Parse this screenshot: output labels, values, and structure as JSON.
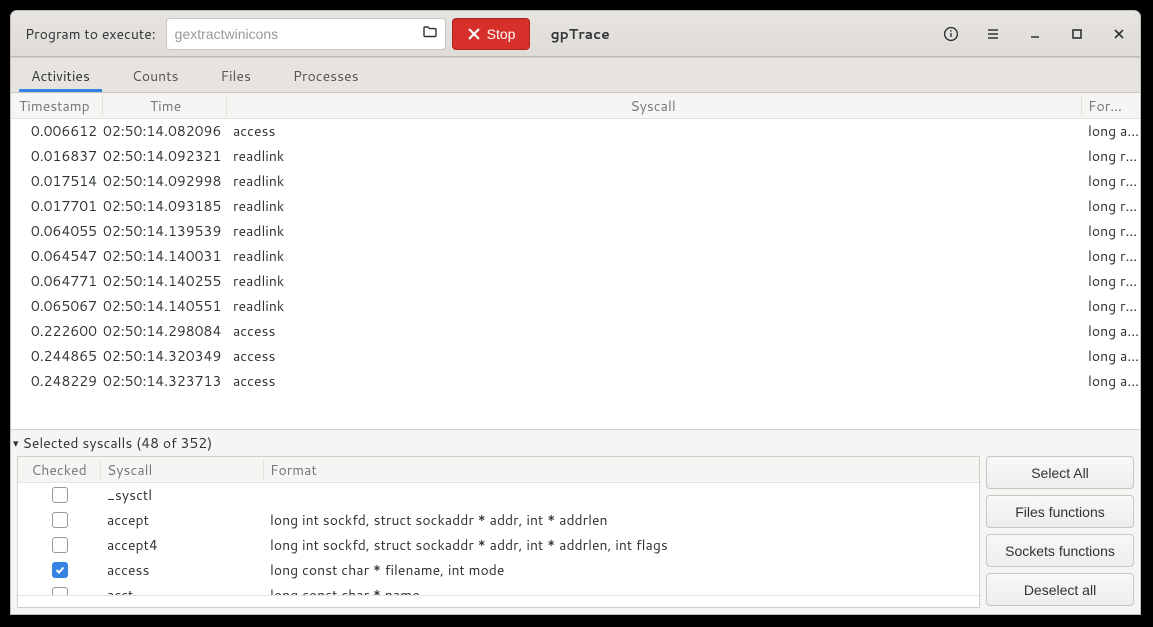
{
  "header": {
    "program_label": "Program to execute:",
    "program_value": "gextractwinicons",
    "stop_label": "Stop",
    "title": "gpTrace"
  },
  "tabs": [
    "Activities",
    "Counts",
    "Files",
    "Processes"
  ],
  "active_tab": 0,
  "activities": {
    "columns": [
      "Timestamp",
      "Time",
      "Syscall",
      "Format"
    ],
    "rows": [
      {
        "ts": "0.006612",
        "time": "02:50:14.082096",
        "sc": "access",
        "fmt": "long a…"
      },
      {
        "ts": "0.016837",
        "time": "02:50:14.092321",
        "sc": "readlink",
        "fmt": "long r…"
      },
      {
        "ts": "0.017514",
        "time": "02:50:14.092998",
        "sc": "readlink",
        "fmt": "long r…"
      },
      {
        "ts": "0.017701",
        "time": "02:50:14.093185",
        "sc": "readlink",
        "fmt": "long r…"
      },
      {
        "ts": "0.064055",
        "time": "02:50:14.139539",
        "sc": "readlink",
        "fmt": "long r…"
      },
      {
        "ts": "0.064547",
        "time": "02:50:14.140031",
        "sc": "readlink",
        "fmt": "long r…"
      },
      {
        "ts": "0.064771",
        "time": "02:50:14.140255",
        "sc": "readlink",
        "fmt": "long r…"
      },
      {
        "ts": "0.065067",
        "time": "02:50:14.140551",
        "sc": "readlink",
        "fmt": "long r…"
      },
      {
        "ts": "0.222600",
        "time": "02:50:14.298084",
        "sc": "access",
        "fmt": "long a…"
      },
      {
        "ts": "0.244865",
        "time": "02:50:14.320349",
        "sc": "access",
        "fmt": "long a…"
      },
      {
        "ts": "0.248229",
        "time": "02:50:14.323713",
        "sc": "access",
        "fmt": "long a…"
      }
    ]
  },
  "expander_label": "Selected syscalls (48 of 352)",
  "syscalls": {
    "columns": [
      "Checked",
      "Syscall",
      "Format"
    ],
    "rows": [
      {
        "chk": false,
        "sc": "_sysctl",
        "fmt": ""
      },
      {
        "chk": false,
        "sc": "accept",
        "fmt": "long int sockfd, struct sockaddr * addr, int * addrlen"
      },
      {
        "chk": false,
        "sc": "accept4",
        "fmt": "long int sockfd, struct sockaddr * addr, int * addrlen, int flags"
      },
      {
        "chk": true,
        "sc": "access",
        "fmt": "long const char * filename, int mode"
      },
      {
        "chk": false,
        "sc": "acct",
        "fmt": "long const char * name"
      }
    ]
  },
  "side_buttons": [
    "Select All",
    "Files functions",
    "Sockets functions",
    "Deselect all"
  ]
}
